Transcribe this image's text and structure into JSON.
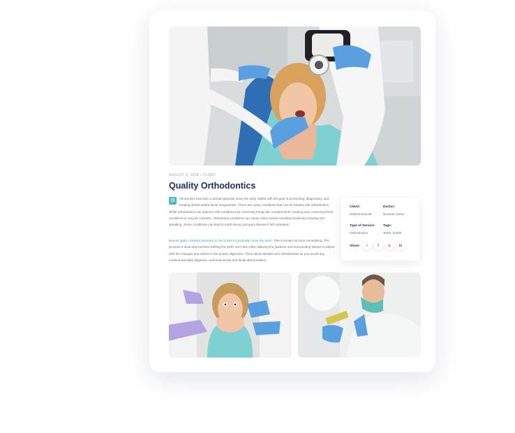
{
  "post": {
    "date": "AUGUST 2, 2018",
    "category": "CLINIC",
    "title": "Quality Orthodontics",
    "dropcap": "O",
    "para1": "rthodontics has been a dental specialty since the early 1900s with the goal of preventing, diagnosing, and treating dental and/or facial irregularities. There are many conditions that can be treated with orthodontics. While orthodontics can improve self-confidence by correcting things like crooked teeth, treating and correcting these conditions is not just cosmetic. Orthodontic problems can cause many issues including hindering chewing and speaking. Some conditions can lead to tooth decay and gum disease if left untreated.",
    "para2_highlight": "Braces apply constant pressure to the bones to gradually move the teeth.",
    "para2_rest": " This is known as bone remodeling. The process is slow and involves shifting the teeth over time while allowing the jawbone and surrounding tissues to adjust with the changes and reform in the proper alignment. Think about dentists and orthodontists as you would any medical specialty diagnose, and treat dental and facial abnormalities."
  },
  "info": {
    "client_label": "Client:",
    "client_value": "WebGeniusLab",
    "doctor_label": "Doctor:",
    "doctor_value": "Norman Colins",
    "service_label": "Type of Service:",
    "service_value": "Orthodontics",
    "tags_label": "Tags:",
    "tags_value": "Teeth, health",
    "share_label": "Share:"
  },
  "share_icons": [
    "twitter-icon",
    "facebook-icon",
    "pinterest-icon",
    "linkedin-icon"
  ],
  "share_glyphs": [
    "t",
    "f",
    "p",
    "in"
  ],
  "colors": {
    "title": "#1b2a63",
    "accent": "#4db6c7",
    "link": "#2fa3d1"
  }
}
